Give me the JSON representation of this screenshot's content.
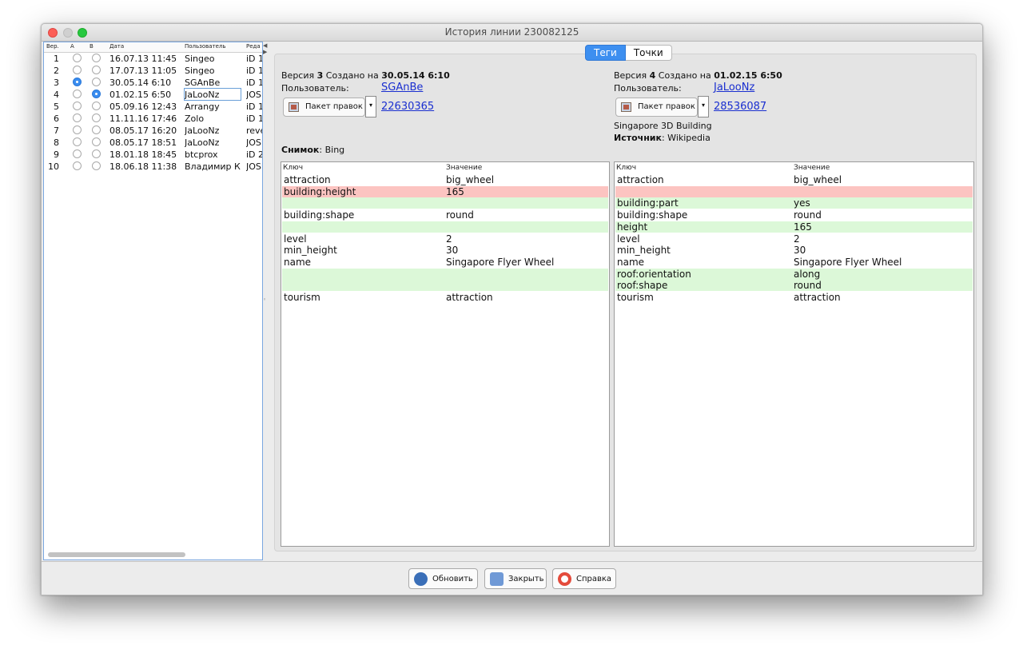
{
  "window": {
    "title": "История линии 230082125"
  },
  "versions_table": {
    "headers": {
      "ver": "Вер.",
      "a": "A",
      "b": "B",
      "date": "Дата",
      "user": "Пользователь",
      "editor": "Реда"
    },
    "rows": [
      {
        "ver": "1",
        "a": false,
        "b": false,
        "date": "16.07.13 11:45",
        "user": "Singeo",
        "editor": "iD 1"
      },
      {
        "ver": "2",
        "a": false,
        "b": false,
        "date": "17.07.13 11:05",
        "user": "Singeo",
        "editor": "iD 1"
      },
      {
        "ver": "3",
        "a": true,
        "b": false,
        "date": "30.05.14 6:10",
        "user": "SGAnBe",
        "editor": "iD 1"
      },
      {
        "ver": "4",
        "a": false,
        "b": true,
        "date": "01.02.15 6:50",
        "user": "JaLooNz",
        "editor": "JOSI"
      },
      {
        "ver": "5",
        "a": false,
        "b": false,
        "date": "05.09.16 12:43",
        "user": "Arrangy",
        "editor": "iD 1"
      },
      {
        "ver": "6",
        "a": false,
        "b": false,
        "date": "11.11.16 17:46",
        "user": "Zolo",
        "editor": "iD 1"
      },
      {
        "ver": "7",
        "a": false,
        "b": false,
        "date": "08.05.17 16:20",
        "user": "JaLooNz",
        "editor": "reve"
      },
      {
        "ver": "8",
        "a": false,
        "b": false,
        "date": "08.05.17 18:51",
        "user": "JaLooNz",
        "editor": "JOSI"
      },
      {
        "ver": "9",
        "a": false,
        "b": false,
        "date": "18.01.18 18:45",
        "user": "btcprox",
        "editor": "iD 2"
      },
      {
        "ver": "10",
        "a": false,
        "b": false,
        "date": "18.06.18 11:38",
        "user": "Владимир К",
        "editor": "JOSI"
      }
    ]
  },
  "tabs": [
    {
      "label": "Теги",
      "active": true
    },
    {
      "label": "Точки",
      "active": false
    }
  ],
  "left_version": {
    "prefix": "Версия",
    "num": "3",
    "created_label": "Создано на",
    "created": "30.05.14 6:10",
    "user_label": "Пользователь:",
    "user": "SGAnBe",
    "changeset_button": "Пакет правок",
    "changeset_id": "22630365",
    "imagery_label": "Снимок",
    "imagery": ": Bing"
  },
  "right_version": {
    "prefix": "Версия",
    "num": "4",
    "created_label": "Создано на",
    "created": "01.02.15 6:50",
    "user_label": "Пользователь:",
    "user": "JaLooNz",
    "changeset_button": "Пакет правок",
    "changeset_id": "28536087",
    "comment": "Singapore 3D Building",
    "source_label": "Источник",
    "source": ": Wikipedia"
  },
  "tag_tables": {
    "key_header": "Ключ",
    "value_header": "Значение",
    "left_rows": [
      {
        "key": "attraction",
        "value": "big_wheel",
        "state": ""
      },
      {
        "key": "building:height",
        "value": "165",
        "state": "red"
      },
      {
        "key": "",
        "value": "",
        "state": "green"
      },
      {
        "key": "building:shape",
        "value": "round",
        "state": ""
      },
      {
        "key": "",
        "value": "",
        "state": "green"
      },
      {
        "key": "level",
        "value": "2",
        "state": ""
      },
      {
        "key": "min_height",
        "value": "30",
        "state": ""
      },
      {
        "key": "name",
        "value": "Singapore Flyer Wheel",
        "state": ""
      },
      {
        "key": "",
        "value": "",
        "state": "green"
      },
      {
        "key": "",
        "value": "",
        "state": "green"
      },
      {
        "key": "tourism",
        "value": "attraction",
        "state": ""
      }
    ],
    "right_rows": [
      {
        "key": "attraction",
        "value": "big_wheel",
        "state": ""
      },
      {
        "key": "",
        "value": "",
        "state": "red"
      },
      {
        "key": "building:part",
        "value": "yes",
        "state": "green"
      },
      {
        "key": "building:shape",
        "value": "round",
        "state": ""
      },
      {
        "key": "height",
        "value": "165",
        "state": "green"
      },
      {
        "key": "level",
        "value": "2",
        "state": ""
      },
      {
        "key": "min_height",
        "value": "30",
        "state": ""
      },
      {
        "key": "name",
        "value": "Singapore Flyer Wheel",
        "state": ""
      },
      {
        "key": "roof:orientation",
        "value": "along",
        "state": "green"
      },
      {
        "key": "roof:shape",
        "value": "round",
        "state": "green"
      },
      {
        "key": "tourism",
        "value": "attraction",
        "state": ""
      }
    ]
  },
  "buttons": {
    "refresh": "Обновить",
    "close": "Закрыть",
    "help": "Справка"
  },
  "colors": {
    "accent": "#3d8ff0",
    "removed": "#fcc4c1",
    "added": "#dcf8d8",
    "link": "#1a2fd0"
  }
}
